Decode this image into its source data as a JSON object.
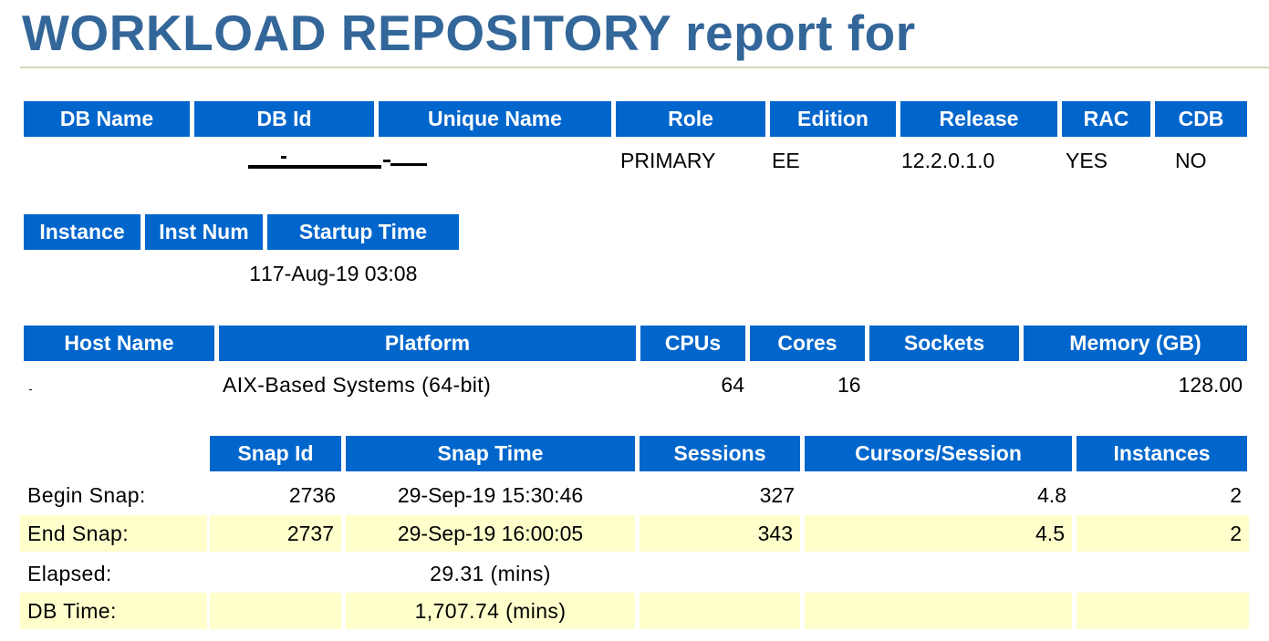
{
  "title": "WORKLOAD REPOSITORY report for",
  "db_table": {
    "headers": [
      "DB Name",
      "DB Id",
      "Unique Name",
      "Role",
      "Edition",
      "Release",
      "RAC",
      "CDB"
    ],
    "row": {
      "db_name": "",
      "db_id": "",
      "unique_name": "",
      "role": "PRIMARY",
      "edition": "EE",
      "release": "12.2.0.1.0",
      "rac": "YES",
      "cdb": "NO"
    }
  },
  "instance_table": {
    "headers": [
      "Instance",
      "Inst Num",
      "Startup Time"
    ],
    "row": {
      "instance": "",
      "inst_num": "1",
      "startup_time": "17-Aug-19 03:08"
    }
  },
  "host_table": {
    "headers": [
      "Host Name",
      "Platform",
      "CPUs",
      "Cores",
      "Sockets",
      "Memory (GB)"
    ],
    "row": {
      "host_name": "",
      "platform": "AIX-Based Systems (64-bit)",
      "cpus": "64",
      "cores": "16",
      "sockets": "",
      "memory_gb": "128.00"
    }
  },
  "snap_table": {
    "headers": [
      "Snap Id",
      "Snap Time",
      "Sessions",
      "Cursors/Session",
      "Instances"
    ],
    "rows": [
      {
        "label": "Begin Snap:",
        "snap_id": "2736",
        "snap_time": "29-Sep-19 15:30:46",
        "sessions": "327",
        "cursors_session": "4.8",
        "instances": "2"
      },
      {
        "label": "End Snap:",
        "snap_id": "2737",
        "snap_time": "29-Sep-19 16:00:05",
        "sessions": "343",
        "cursors_session": "4.5",
        "instances": "2"
      },
      {
        "label": "Elapsed:",
        "snap_id": "",
        "snap_time": "29.31 (mins)",
        "sessions": "",
        "cursors_session": "",
        "instances": ""
      },
      {
        "label": "DB Time:",
        "snap_id": "",
        "snap_time": "1,707.74 (mins)",
        "sessions": "",
        "cursors_session": "",
        "instances": ""
      }
    ]
  },
  "colors": {
    "title": "#336699",
    "header_bg": "#0066cc",
    "header_text": "#ffffff",
    "alt_row": "#ffffcc"
  }
}
